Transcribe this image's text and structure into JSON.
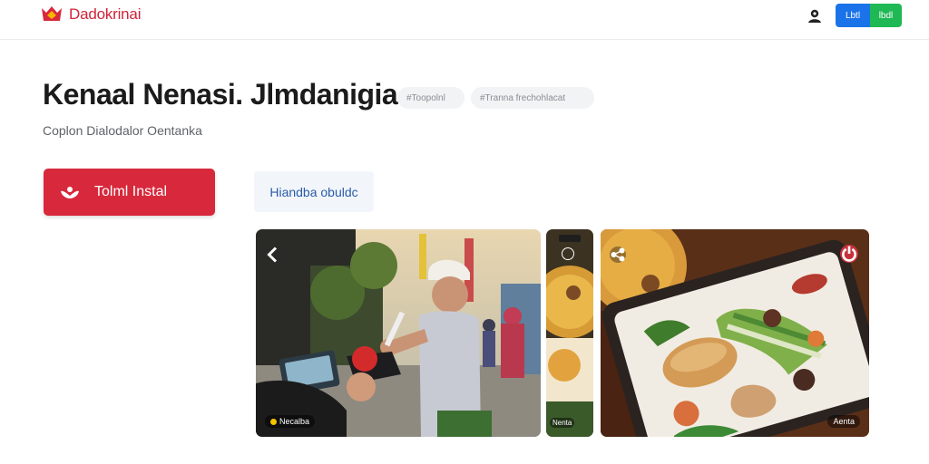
{
  "header": {
    "brand_name": "Dadokrinai",
    "button_primary_label": "Lbtl",
    "button_secondary_label": "lbdl",
    "accent_color": "#d8283b",
    "primary_button_color": "#1a73e8",
    "secondary_button_color": "#1eb854"
  },
  "main": {
    "title": "Kenaal Nenasi. Jlmdanigia.",
    "tags": [
      "#Toopolnl",
      "#Tranna frechohlacat"
    ],
    "subtitle": "Coplon Dialodalor Oentanka",
    "install_label": "Tolml Instal",
    "secondary_label": "Hiandba obuldc"
  },
  "gallery": {
    "shots": [
      {
        "caption": "Necalba",
        "nav_icon": "chevron-left-icon"
      },
      {
        "caption": "Nenta",
        "nav_icon": "circle-icon"
      },
      {
        "caption": "Aenta",
        "nav_icon": "share-icon",
        "extra_icon": "power-icon"
      }
    ]
  }
}
